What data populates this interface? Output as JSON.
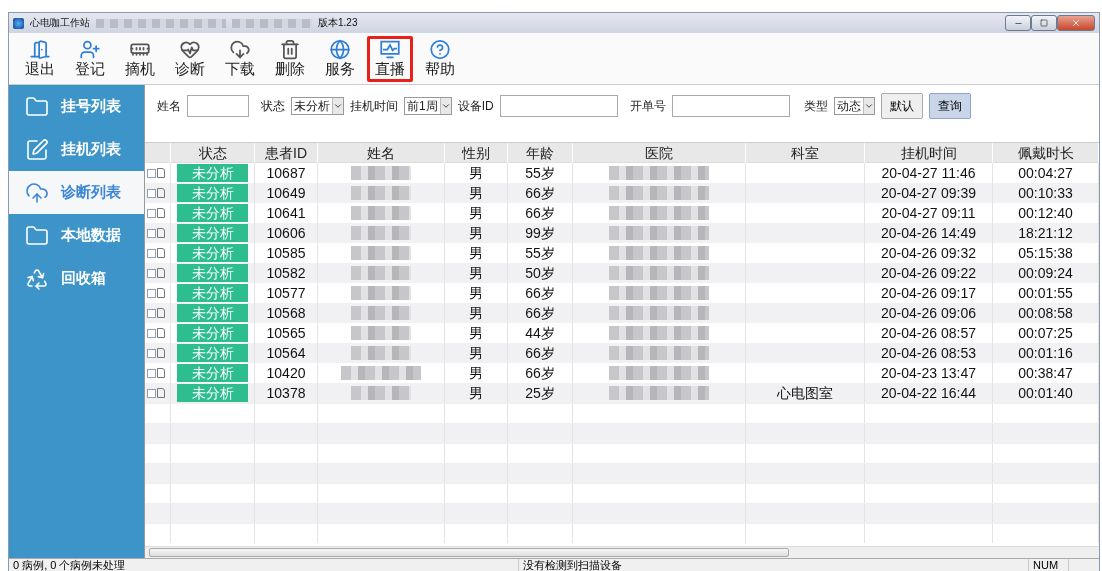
{
  "window": {
    "title": "心电咖工作站",
    "version": "版本1.23"
  },
  "toolbar": [
    {
      "kind": "exit",
      "label": "退出",
      "selected": false
    },
    {
      "kind": "register",
      "label": "登记",
      "selected": false
    },
    {
      "kind": "card",
      "label": "摘机",
      "selected": false
    },
    {
      "kind": "heart",
      "label": "诊断",
      "selected": false
    },
    {
      "kind": "download",
      "label": "下载",
      "selected": false
    },
    {
      "kind": "trash",
      "label": "删除",
      "selected": false
    },
    {
      "kind": "globe",
      "label": "服务",
      "selected": false
    },
    {
      "kind": "monitor",
      "label": "直播",
      "selected": true
    },
    {
      "kind": "help",
      "label": "帮助",
      "selected": false
    }
  ],
  "sidebar": {
    "items": [
      {
        "kind": "folder",
        "label": "挂号列表",
        "selected": false
      },
      {
        "kind": "edit",
        "label": "挂机列表",
        "selected": false
      },
      {
        "kind": "cloud",
        "label": "诊断列表",
        "selected": true
      },
      {
        "kind": "folder",
        "label": "本地数据",
        "selected": false
      },
      {
        "kind": "recycle",
        "label": "回收箱",
        "selected": false
      }
    ]
  },
  "filters": {
    "name_label": "姓名",
    "status_label": "状态",
    "status_value": "未分析",
    "time_label": "挂机时间",
    "time_value": "前1周",
    "device_label": "设备ID",
    "order_label": "开单号",
    "type_label": "类型",
    "type_value": "动态",
    "buttons": [
      {
        "label": "默认",
        "selected": false
      },
      {
        "label": "查询",
        "selected": true
      }
    ]
  },
  "table": {
    "columns": [
      "状态",
      "患者ID",
      "姓名",
      "性别",
      "年龄",
      "医院",
      "科室",
      "挂机时间",
      "佩戴时长"
    ],
    "rows": [
      {
        "checked": false,
        "status": "未分析",
        "id": "10687",
        "sex": "男",
        "age": "55岁",
        "dept": "",
        "time": "20-04-27 11:46",
        "duration": "00:04:27"
      },
      {
        "checked": false,
        "status": "未分析",
        "id": "10649",
        "sex": "男",
        "age": "66岁",
        "dept": "",
        "time": "20-04-27 09:39",
        "duration": "00:10:33"
      },
      {
        "checked": false,
        "status": "未分析",
        "id": "10641",
        "sex": "男",
        "age": "66岁",
        "dept": "",
        "time": "20-04-27 09:11",
        "duration": "00:12:40"
      },
      {
        "checked": false,
        "status": "未分析",
        "id": "10606",
        "sex": "男",
        "age": "99岁",
        "dept": "",
        "time": "20-04-26 14:49",
        "duration": "18:21:12"
      },
      {
        "checked": false,
        "status": "未分析",
        "id": "10585",
        "sex": "男",
        "age": "55岁",
        "dept": "",
        "time": "20-04-26 09:32",
        "duration": "05:15:38"
      },
      {
        "checked": false,
        "status": "未分析",
        "id": "10582",
        "sex": "男",
        "age": "50岁",
        "dept": "",
        "time": "20-04-26 09:22",
        "duration": "00:09:24"
      },
      {
        "checked": false,
        "status": "未分析",
        "id": "10577",
        "sex": "男",
        "age": "66岁",
        "dept": "",
        "time": "20-04-26 09:17",
        "duration": "00:01:55"
      },
      {
        "checked": false,
        "status": "未分析",
        "id": "10568",
        "sex": "男",
        "age": "66岁",
        "dept": "",
        "time": "20-04-26 09:06",
        "duration": "00:08:58"
      },
      {
        "checked": false,
        "status": "未分析",
        "id": "10565",
        "sex": "男",
        "age": "44岁",
        "dept": "",
        "time": "20-04-26 08:57",
        "duration": "00:07:25"
      },
      {
        "checked": false,
        "status": "未分析",
        "id": "10564",
        "sex": "男",
        "age": "66岁",
        "dept": "",
        "time": "20-04-26 08:53",
        "duration": "00:01:16"
      },
      {
        "checked": false,
        "status": "未分析",
        "id": "10420",
        "sex": "男",
        "age": "66岁",
        "dept": "",
        "time": "20-04-23 13:47",
        "duration": "00:38:47"
      },
      {
        "checked": false,
        "status": "未分析",
        "id": "10378",
        "sex": "男",
        "age": "25岁",
        "dept": "心电图室",
        "time": "20-04-22 16:44",
        "duration": "00:01:40"
      }
    ]
  },
  "status_bar": {
    "cases": "0 病例, 0 个病例未处理",
    "scanner": "没有检测到扫描设备",
    "num": "NUM"
  }
}
